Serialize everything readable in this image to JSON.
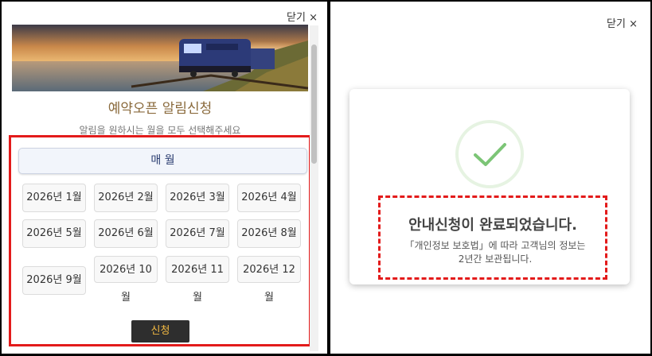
{
  "left_panel": {
    "close_label": "닫기 ×",
    "title": "예약오픈 알림신청",
    "subtitle": "알림을 원하시는 월을 모두 선택해주세요",
    "all_label": "매 월",
    "months": [
      {
        "line1": "2026년 1월",
        "line2": ""
      },
      {
        "line1": "2026년 2월",
        "line2": ""
      },
      {
        "line1": "2026년 3월",
        "line2": ""
      },
      {
        "line1": "2026년 4월",
        "line2": ""
      },
      {
        "line1": "2026년 5월",
        "line2": ""
      },
      {
        "line1": "2026년 6월",
        "line2": ""
      },
      {
        "line1": "2026년 7월",
        "line2": ""
      },
      {
        "line1": "2026년 8월",
        "line2": ""
      },
      {
        "line1": "2026년 9월",
        "line2": ""
      },
      {
        "line1": "2026년 10",
        "line2": "월"
      },
      {
        "line1": "2026년 11",
        "line2": "월"
      },
      {
        "line1": "2026년 12",
        "line2": "월"
      }
    ],
    "submit_label": "신청"
  },
  "right_panel": {
    "close_label": "닫기 ×",
    "message_title": "안내신청이 완료되었습니다.",
    "message_line1": "「개인정보 보호법」에 따라 고객님의 정보는",
    "message_line2": "2년간 보관됩니다."
  },
  "colors": {
    "highlight_border": "#e31b1b",
    "title_gold": "#8a6a3c",
    "submit_bg": "#2e2e2e",
    "submit_text": "#f2b942",
    "check_green": "#7cc576"
  }
}
